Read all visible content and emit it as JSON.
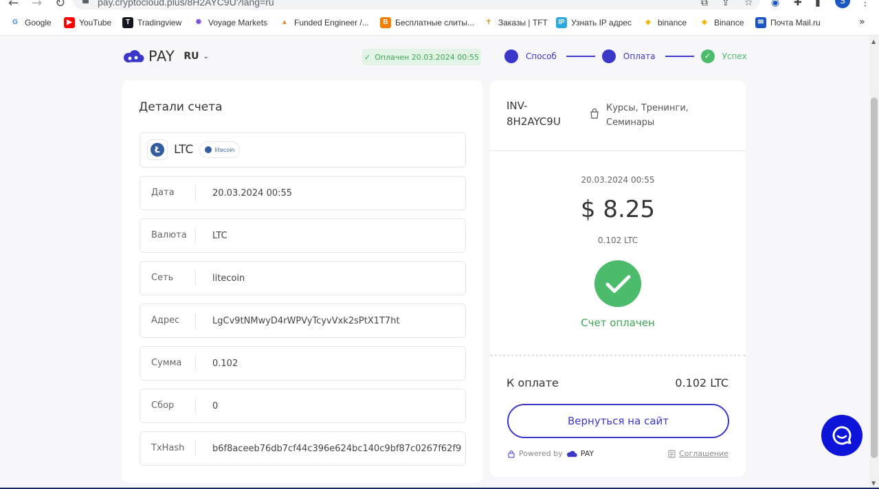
{
  "browser": {
    "url": "pay.cryptocloud.plus/8H2AYC9U?lang=ru",
    "profile_initial": "S",
    "bookmarks": [
      {
        "label": "Google",
        "icon": "google-icon",
        "color": "#4285f4"
      },
      {
        "label": "YouTube",
        "icon": "youtube-icon",
        "color": "#ff0000"
      },
      {
        "label": "Tradingview",
        "icon": "tradingview-icon",
        "color": "#131722"
      },
      {
        "label": "Voyage Markets",
        "icon": "voyage-icon",
        "color": "#7b4fd6"
      },
      {
        "label": "Funded Engineer /...",
        "icon": "funded-icon",
        "color": "#e58a2c"
      },
      {
        "label": "Бесплатные слиты...",
        "icon": "blogger-icon",
        "color": "#f57d00"
      },
      {
        "label": "Заказы | TFT",
        "icon": "tft-icon",
        "color": "#e0a030"
      },
      {
        "label": "Узнать IP адрес",
        "icon": "ip-icon",
        "color": "#29a9e0"
      },
      {
        "label": "binance",
        "icon": "binance-icon",
        "color": "#f0b90b"
      },
      {
        "label": "Binance",
        "icon": "binance-icon",
        "color": "#f0b90b"
      },
      {
        "label": "Почта Mail.ru",
        "icon": "mail-icon",
        "color": "#1a56c4"
      }
    ]
  },
  "header": {
    "brand": "PAY",
    "lang": "RU",
    "paid_badge": "Оплачен 20.03.2024 00:55",
    "steps": [
      {
        "label": "Способ",
        "done": false
      },
      {
        "label": "Оплата",
        "done": false
      },
      {
        "label": "Успех",
        "done": true
      }
    ]
  },
  "details": {
    "title": "Детали счета",
    "coin": "LTC",
    "coin_tag": "litecoin",
    "rows": [
      {
        "label": "Дата",
        "value": "20.03.2024 00:55"
      },
      {
        "label": "Валюта",
        "value": "LTC"
      },
      {
        "label": "Сеть",
        "value": "litecoin"
      },
      {
        "label": "Адрес",
        "value": "LgCv9tNMwyD4rWPVyTcyvVxk2sPtX1T7ht"
      },
      {
        "label": "Сумма",
        "value": "0.102"
      },
      {
        "label": "Сбор",
        "value": "0"
      },
      {
        "label": "TxHash",
        "value": "b6f8aceeb76db7cf44c396e624bc140c9bf87c0267f62f9"
      }
    ]
  },
  "invoice": {
    "id_line1": "INV-",
    "id_line2": "8H2AYC9U",
    "category_line1": "Курсы, Тренинги,",
    "category_line2": "Семинары",
    "date": "20.03.2024 00:55",
    "amount_usd": "$ 8.25",
    "amount_crypto": "0.102 LTC",
    "status": "Счет оплачен",
    "to_pay_label": "К оплате",
    "to_pay_value": "0.102 LTC",
    "back_button": "Вернуться на сайт",
    "powered_by": "Powered by",
    "powered_brand": "PAY",
    "agreement": "Соглашение"
  },
  "colors": {
    "accent": "#3a37c9",
    "success": "#4cbb6c",
    "chat": "#0e15d8"
  }
}
